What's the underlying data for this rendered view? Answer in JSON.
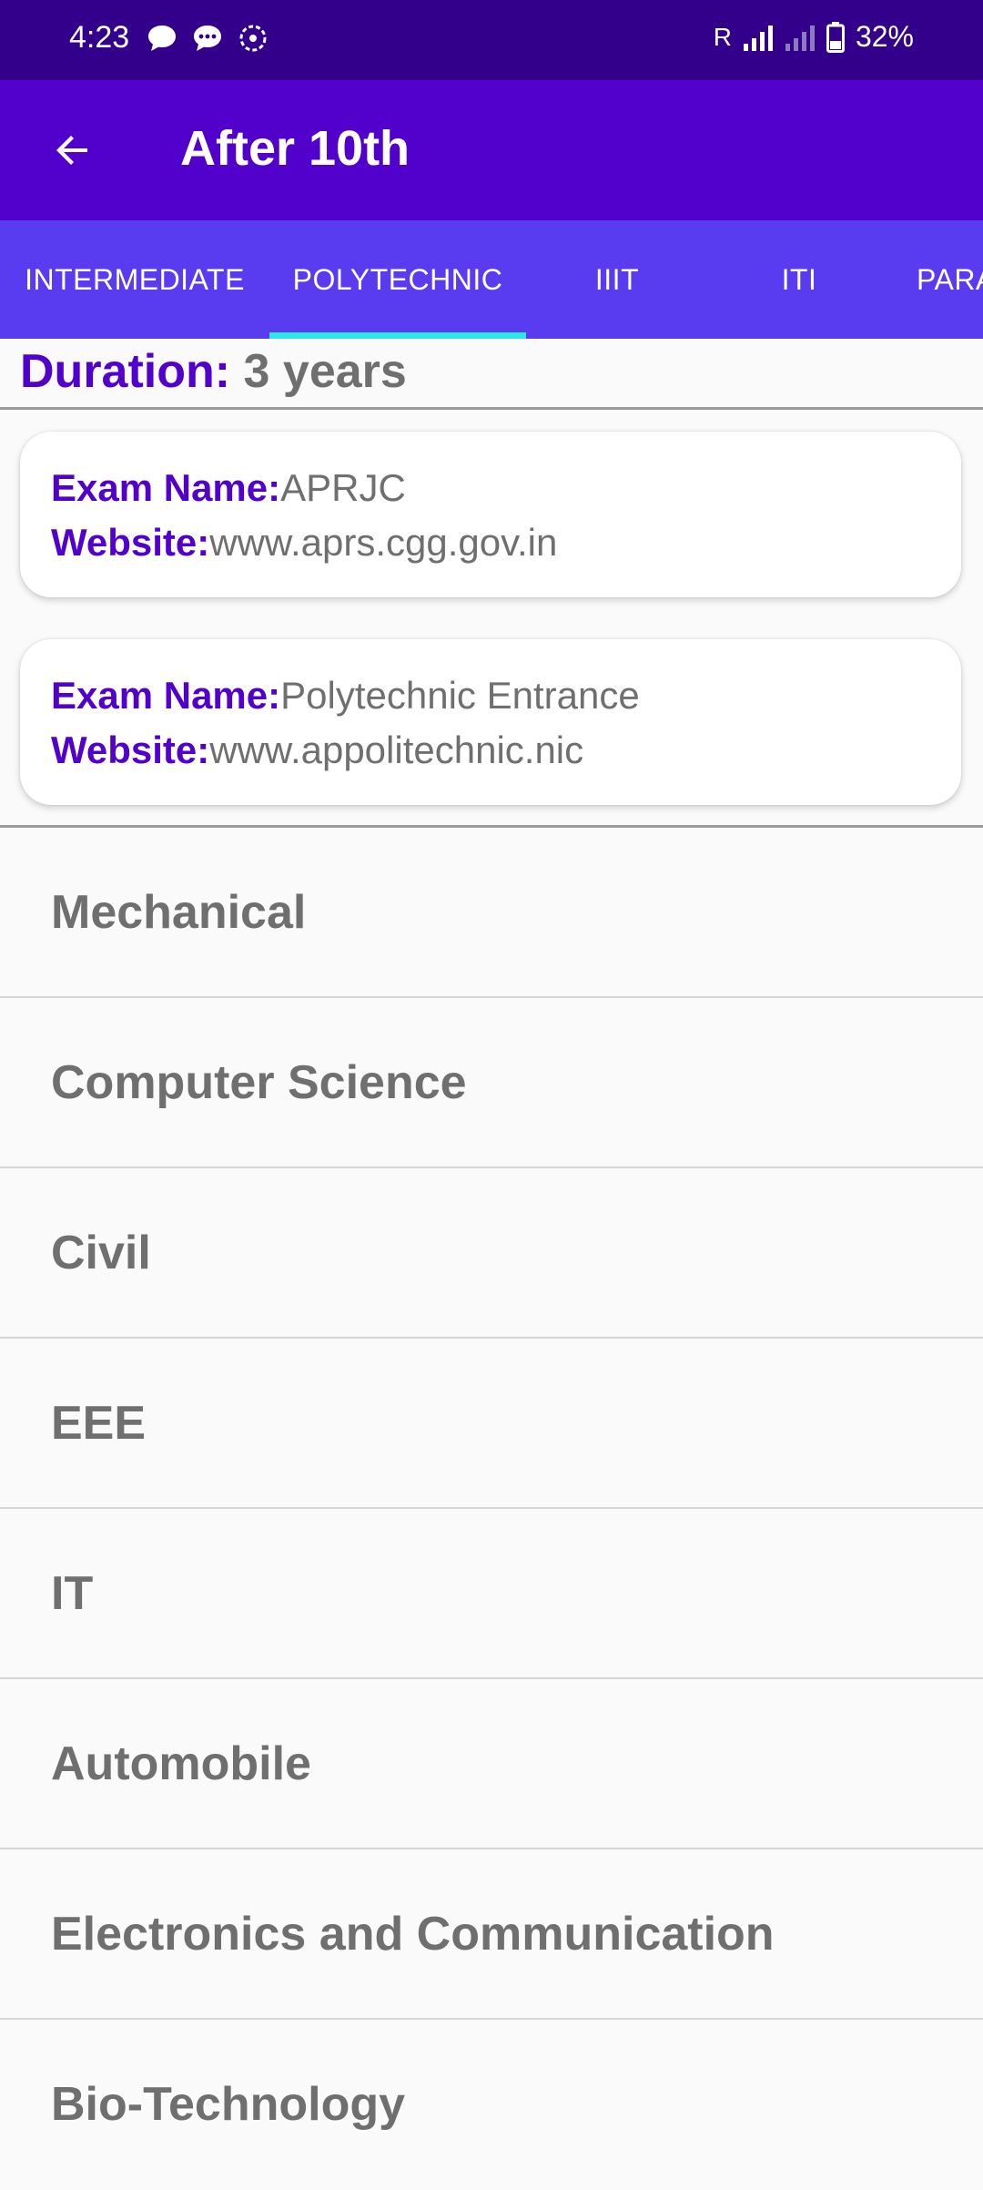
{
  "status_bar": {
    "time": "4:23",
    "carrier_indicator": "R",
    "battery": "32%"
  },
  "app_bar": {
    "title": "After 10th"
  },
  "tabs": [
    {
      "label": "INTERMEDIATE",
      "selected": false
    },
    {
      "label": "POLYTECHNIC",
      "selected": true
    },
    {
      "label": "IIIT",
      "selected": false
    },
    {
      "label": "ITI",
      "selected": false
    },
    {
      "label": "PARA",
      "selected": false
    }
  ],
  "duration": {
    "label": "Duration:",
    "value": "3 years"
  },
  "exams": [
    {
      "name_label": "Exam Name:",
      "name": "APRJC",
      "website_label": "Website:",
      "website": "www.aprs.cgg.gov.in"
    },
    {
      "name_label": "Exam Name:",
      "name": "Polytechnic Entrance",
      "website_label": "Website:",
      "website": "www.appolitechnic.nic"
    }
  ],
  "courses": [
    "Mechanical",
    "Computer Science",
    "Civil",
    "EEE",
    "IT",
    "Automobile",
    "Electronics and Communication",
    "Bio-Technology"
  ],
  "colors": {
    "status_bar": "#32008a",
    "app_bar": "#5200cc",
    "tab_bar": "#5a3cf0",
    "tab_indicator": "#2ee6e6",
    "accent_text": "#5200cc",
    "body_text": "#6f6f6f"
  },
  "icons": {
    "back": "arrow-back-icon",
    "chat": "chat-bubble-icon",
    "message": "message-icon",
    "sync": "sync-icon",
    "signal": "signal-icon",
    "battery": "battery-icon"
  }
}
